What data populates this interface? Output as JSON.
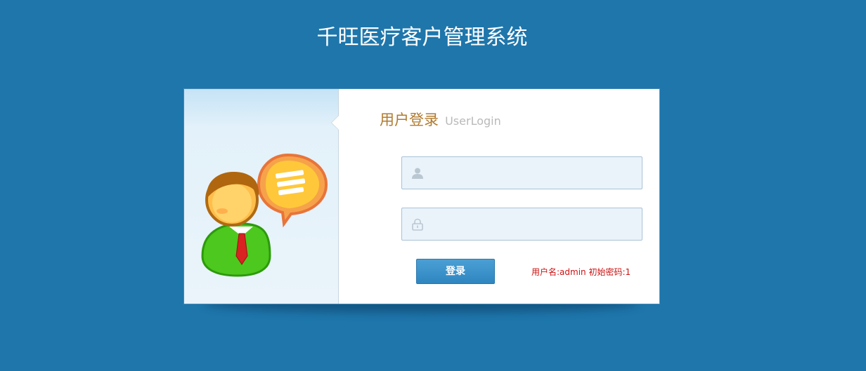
{
  "header": {
    "title": "千旺医疗客户管理系统"
  },
  "login": {
    "heading_cn": "用户登录",
    "heading_en": "UserLogin",
    "username_placeholder": "",
    "password_placeholder": "",
    "button_label": "登录",
    "hint": "用户名:admin 初始密码:1"
  },
  "icons": {
    "username": "user-icon",
    "password": "lock-icon",
    "illustration": "user-chat-illustration"
  },
  "colors": {
    "background": "#1e76ab",
    "heading": "#b07a2e",
    "button": "#3a92c9",
    "hint": "#cc1111"
  }
}
